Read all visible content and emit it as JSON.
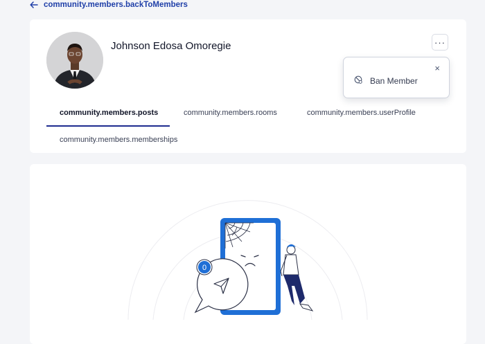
{
  "back_link": {
    "label": "community.members.backToMembers",
    "icon": "arrow-left-icon"
  },
  "member": {
    "name": "Johnson Edosa Omoregie"
  },
  "more_button": {
    "label": "···"
  },
  "menu": {
    "close": "×",
    "items": [
      {
        "label": "Ban Member",
        "icon": "ban-icon"
      }
    ]
  },
  "tabs": [
    {
      "label": "community.members.posts",
      "active": true
    },
    {
      "label": "community.members.rooms",
      "active": false
    },
    {
      "label": "community.members.userProfile",
      "active": false
    },
    {
      "label": "community.members.memberships",
      "active": false
    }
  ],
  "empty_state": {
    "badge_count": "0"
  },
  "colors": {
    "accent": "#1f6fd6",
    "link": "#1f3fa8",
    "tab_underline": "#1d2b8f"
  }
}
